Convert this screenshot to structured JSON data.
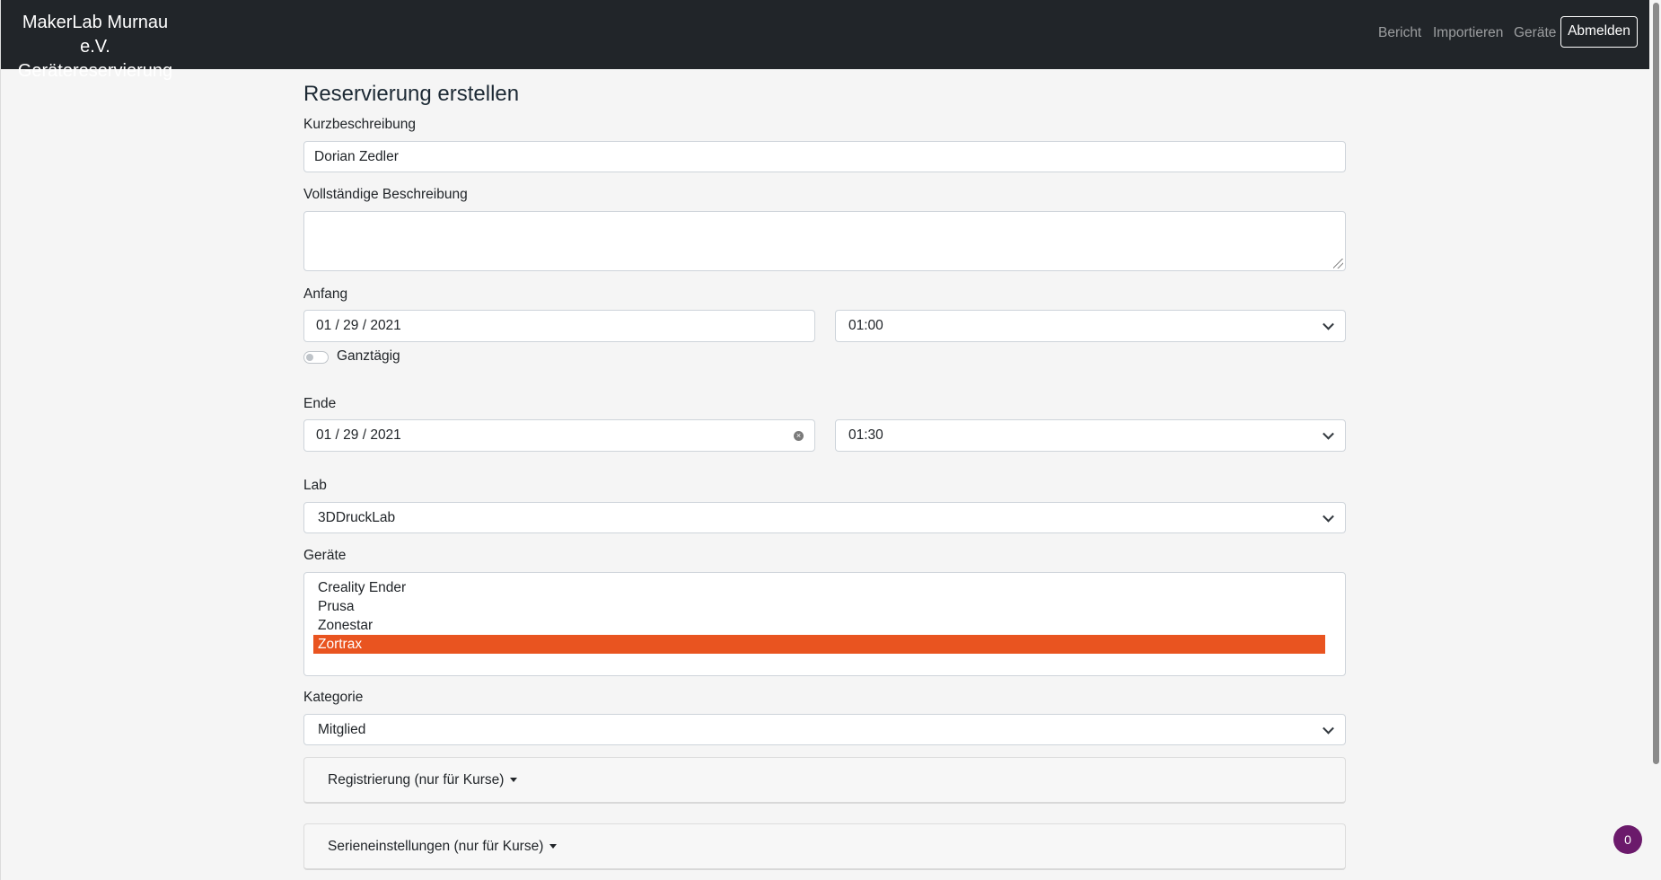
{
  "navbar": {
    "brand_line1": "MakerLab Murnau e.V.",
    "brand_line2": "Gerätereservierung",
    "links": [
      "Bericht",
      "Importieren",
      "Geräte"
    ],
    "logout": "Abmelden"
  },
  "form": {
    "title": "Reservierung erstellen",
    "short_desc": {
      "label": "Kurzbeschreibung",
      "value": "Dorian Zedler"
    },
    "full_desc": {
      "label": "Vollständige Beschreibung",
      "value": ""
    },
    "start": {
      "label": "Anfang",
      "date": "01 / 29 / 2021",
      "time": "01:00"
    },
    "all_day": {
      "label": "Ganztägig",
      "checked": false
    },
    "end": {
      "label": "Ende",
      "date": "01 / 29 / 2021",
      "time": "01:30"
    },
    "lab": {
      "label": "Lab",
      "value": "3DDruckLab"
    },
    "devices": {
      "label": "Geräte",
      "options": [
        "Creality Ender",
        "Prusa",
        "Zonestar",
        "Zortrax"
      ],
      "selected": "Zortrax"
    },
    "category": {
      "label": "Kategorie",
      "value": "Mitglied"
    },
    "registration": "Registrierung (nur für Kurse)",
    "series": "Serieneinstellungen (nur für Kurse)"
  },
  "fab_count": "0",
  "colors": {
    "navbar": "#212529",
    "accent": "#e95420",
    "fab": "#6b1a6b"
  }
}
